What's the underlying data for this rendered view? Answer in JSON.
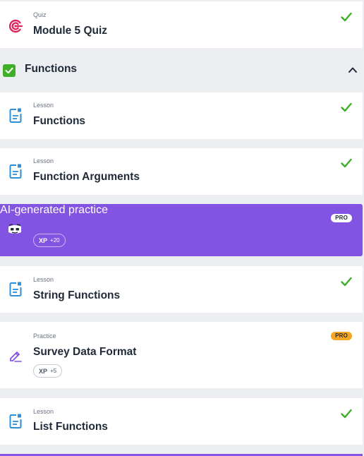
{
  "quiz_item": {
    "kind": "Quiz",
    "title": "Module 5 Quiz",
    "icon": "target-icon",
    "completed": true
  },
  "section": {
    "title": "Functions",
    "completed": true,
    "expanded": true,
    "chevron_icon": "chevron-up-icon"
  },
  "items": [
    {
      "kind": "Lesson",
      "title": "Functions",
      "icon": "lesson-doc-icon",
      "completed": true
    },
    {
      "kind": "Lesson",
      "title": "Function Arguments",
      "icon": "lesson-doc-icon",
      "completed": true
    },
    {
      "kind": "",
      "title": "AI-generated practice",
      "icon": "ai-robot-icon",
      "badge": "PRO",
      "xp_label": "XP",
      "xp_value": "+20"
    },
    {
      "kind": "Lesson",
      "title": "String Functions",
      "icon": "lesson-doc-icon",
      "completed": true
    },
    {
      "kind": "Practice",
      "title": "Survey Data Format",
      "icon": "practice-pencil-icon",
      "badge": "PRO",
      "xp_label": "XP",
      "xp_value": "+5"
    },
    {
      "kind": "Lesson",
      "title": "List Functions",
      "icon": "lesson-doc-icon",
      "completed": true
    }
  ],
  "colors": {
    "accent_purple": "#8353e2",
    "check_green": "#3fae29",
    "lesson_blue": "#2d8fd6",
    "quiz_pink": "#e0245e",
    "pro_orange": "#f5a623",
    "background": "#eceef2"
  }
}
